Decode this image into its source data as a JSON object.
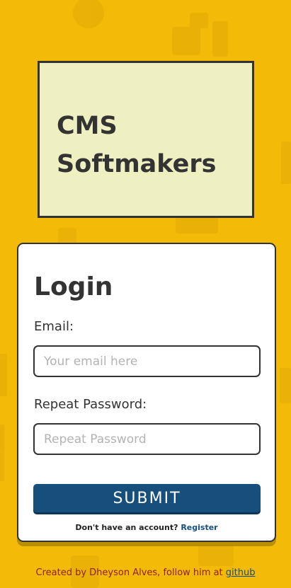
{
  "brand": {
    "title": "CMS Softmakers"
  },
  "login": {
    "title": "Login",
    "email_label": "Email:",
    "email_placeholder": "Your email here",
    "email_value": "",
    "password_label": "Repeat Password:",
    "password_placeholder": "Repeat Password",
    "password_value": "",
    "submit_label": "SUBMIT",
    "register_prompt": "Don't have an account?",
    "register_link": "Register"
  },
  "footer": {
    "text": "Created by Dheyson Alves, follow him at",
    "link": "github"
  },
  "colors": {
    "background": "#f3bb07",
    "brand_box": "#eff0c1",
    "accent": "#164f7c",
    "footer_text": "#8c1d10",
    "ink": "#333333"
  }
}
